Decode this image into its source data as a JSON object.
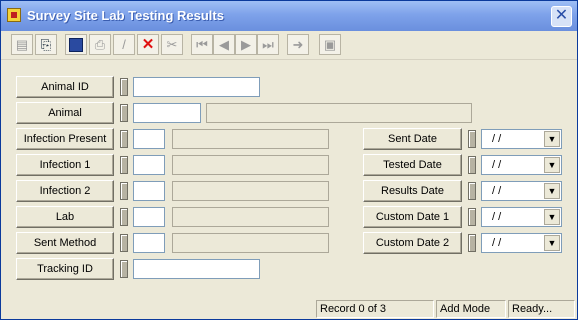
{
  "window": {
    "title": "Survey Site Lab Testing Results",
    "close_label": "✕"
  },
  "toolbar": {
    "buttons": [
      {
        "icon": "properties-icon",
        "glyph": "▤"
      },
      {
        "icon": "open-icon",
        "glyph": "⎘"
      },
      {
        "icon": "save-icon",
        "glyph": ""
      },
      {
        "icon": "print-icon",
        "glyph": "⎙"
      },
      {
        "icon": "edit-icon",
        "glyph": "/"
      },
      {
        "icon": "delete-icon",
        "glyph": "✕"
      },
      {
        "icon": "cut-icon",
        "glyph": "✂"
      },
      {
        "icon": "first-record-icon",
        "glyph": "⏮"
      },
      {
        "icon": "previous-record-icon",
        "glyph": "◀"
      },
      {
        "icon": "next-record-icon",
        "glyph": "▶"
      },
      {
        "icon": "last-record-icon",
        "glyph": "⏭"
      },
      {
        "icon": "goto-record-icon",
        "glyph": "➜"
      },
      {
        "icon": "form-icon",
        "glyph": "▣"
      }
    ]
  },
  "left_fields": {
    "animal_id": "Animal ID",
    "animal": "Animal",
    "infection_present": "Infection Present",
    "infection_1": "Infection 1",
    "infection_2": "Infection 2",
    "lab": "Lab",
    "sent_method": "Sent Method",
    "tracking_id": "Tracking ID"
  },
  "right_fields": {
    "sent_date": {
      "label": "Sent Date",
      "value": " /  /"
    },
    "tested_date": {
      "label": "Tested Date",
      "value": " /  /"
    },
    "results_date": {
      "label": "Results Date",
      "value": " /  /"
    },
    "custom_date_1": {
      "label": "Custom Date 1",
      "value": " /  /"
    },
    "custom_date_2": {
      "label": "Custom Date 2",
      "value": " /  /"
    }
  },
  "status": {
    "record": "Record 0 of 3",
    "mode": "Add Mode",
    "state": "Ready..."
  }
}
